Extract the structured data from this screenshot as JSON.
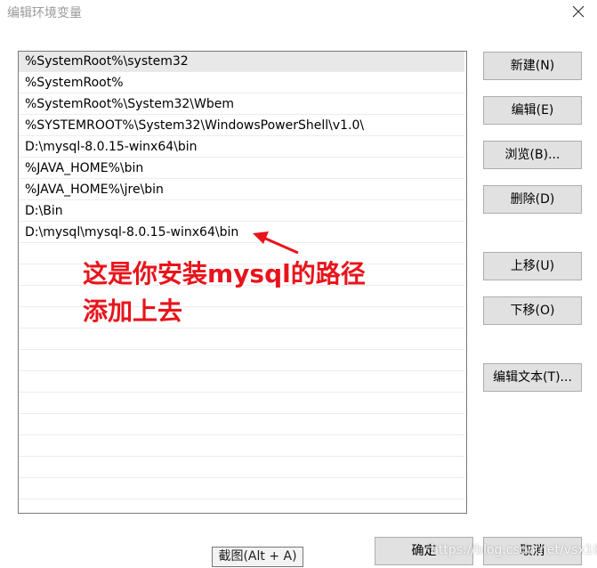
{
  "window": {
    "title": "编辑环境变量"
  },
  "paths": [
    "%SystemRoot%\\system32",
    "%SystemRoot%",
    "%SystemRoot%\\System32\\Wbem",
    "%SYSTEMROOT%\\System32\\WindowsPowerShell\\v1.0\\",
    "D:\\mysql-8.0.15-winx64\\bin",
    "%JAVA_HOME%\\bin",
    "%JAVA_HOME%\\jre\\bin",
    "D:\\Bin",
    "D:\\mysql\\mysql-8.0.15-winx64\\bin"
  ],
  "buttons": {
    "new": "新建(N)",
    "edit": "编辑(E)",
    "browse": "浏览(B)...",
    "delete": "删除(D)",
    "move_up": "上移(U)",
    "move_down": "下移(O)",
    "edit_text": "编辑文本(T)...",
    "ok": "确定",
    "cancel": "取消"
  },
  "annotation": {
    "line1": "这是你安装mysql的路径",
    "line2": "添加上去"
  },
  "tooltip": "截图(Alt + A)",
  "watermark": "https://blog.csdn.net/vsx101",
  "colors": {
    "annotation": "#e8141b",
    "selected_row": "#e8e8e8",
    "button_face": "#e1e1e1"
  }
}
